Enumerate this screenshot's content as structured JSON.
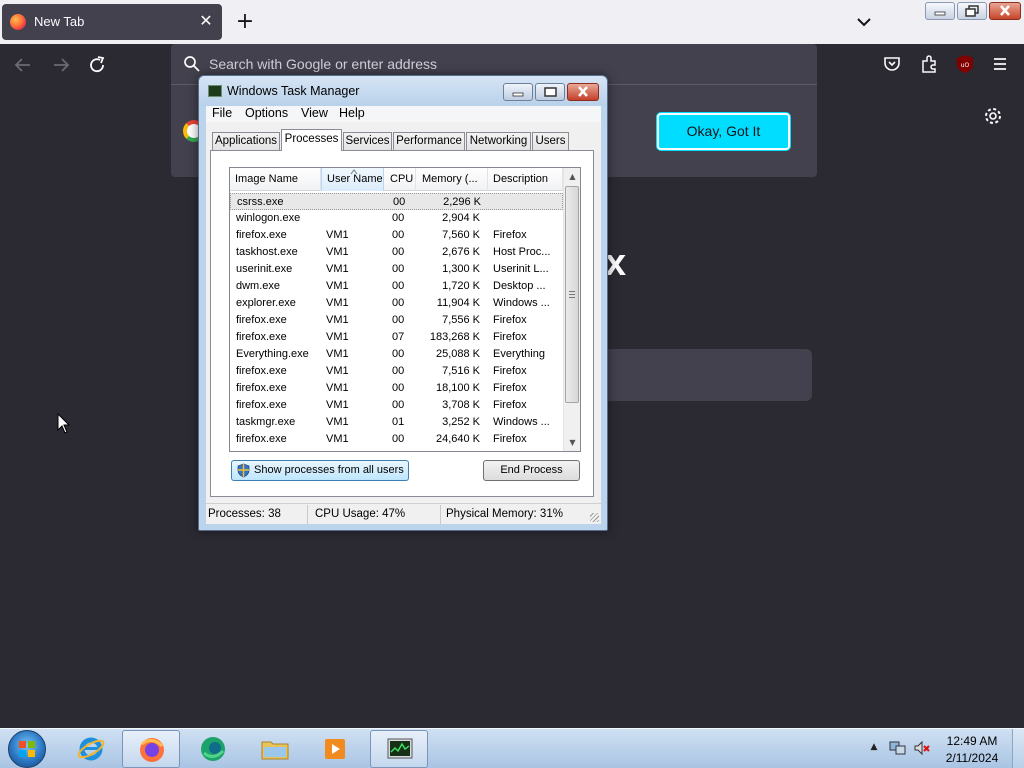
{
  "browser": {
    "tab_title": "New Tab",
    "tab_close": "✕",
    "new_tab": "+",
    "urlbar_placeholder": "Search with Google or enter address",
    "okay_button": "Okay, Got It",
    "wordmark_fragment": "x",
    "icons": {
      "tab": "firefox-icon",
      "back": "back-arrow-icon",
      "forward": "forward-arrow-icon",
      "reload": "reload-icon",
      "search": "search-icon",
      "google": "google-icon",
      "pocket": "pocket-icon",
      "extensions": "extensions-icon",
      "ublock": "ublock-origin-icon",
      "menu": "hamburger-menu-icon",
      "settings": "gear-icon"
    },
    "colors": {
      "accent": "#00ddff",
      "dark_bg": "#2b2a33",
      "panel_bg": "#42414d"
    }
  },
  "task_manager": {
    "title": "Windows Task Manager",
    "menu": [
      "File",
      "Options",
      "View",
      "Help"
    ],
    "tabs": [
      "Applications",
      "Processes",
      "Services",
      "Performance",
      "Networking",
      "Users"
    ],
    "active_tab": "Processes",
    "columns": [
      "Image Name",
      "User Name",
      "CPU",
      "Memory (...",
      "Description"
    ],
    "sorted_column": "User Name",
    "processes": [
      {
        "name": "csrss.exe",
        "user": "",
        "cpu": "00",
        "memory": "2,296 K",
        "description": ""
      },
      {
        "name": "winlogon.exe",
        "user": "",
        "cpu": "00",
        "memory": "2,904 K",
        "description": ""
      },
      {
        "name": "firefox.exe",
        "user": "VM1",
        "cpu": "00",
        "memory": "7,560 K",
        "description": "Firefox"
      },
      {
        "name": "taskhost.exe",
        "user": "VM1",
        "cpu": "00",
        "memory": "2,676 K",
        "description": "Host Proc..."
      },
      {
        "name": "userinit.exe",
        "user": "VM1",
        "cpu": "00",
        "memory": "1,300 K",
        "description": "Userinit L..."
      },
      {
        "name": "dwm.exe",
        "user": "VM1",
        "cpu": "00",
        "memory": "1,720 K",
        "description": "Desktop ..."
      },
      {
        "name": "explorer.exe",
        "user": "VM1",
        "cpu": "00",
        "memory": "11,904 K",
        "description": "Windows ..."
      },
      {
        "name": "firefox.exe",
        "user": "VM1",
        "cpu": "00",
        "memory": "7,556 K",
        "description": "Firefox"
      },
      {
        "name": "firefox.exe",
        "user": "VM1",
        "cpu": "07",
        "memory": "183,268 K",
        "description": "Firefox"
      },
      {
        "name": "Everything.exe",
        "user": "VM1",
        "cpu": "00",
        "memory": "25,088 K",
        "description": "Everything"
      },
      {
        "name": "firefox.exe",
        "user": "VM1",
        "cpu": "00",
        "memory": "7,516 K",
        "description": "Firefox"
      },
      {
        "name": "firefox.exe",
        "user": "VM1",
        "cpu": "00",
        "memory": "18,100 K",
        "description": "Firefox"
      },
      {
        "name": "firefox.exe",
        "user": "VM1",
        "cpu": "00",
        "memory": "3,708 K",
        "description": "Firefox"
      },
      {
        "name": "taskmgr.exe",
        "user": "VM1",
        "cpu": "01",
        "memory": "3,252 K",
        "description": "Windows ..."
      },
      {
        "name": "firefox.exe",
        "user": "VM1",
        "cpu": "00",
        "memory": "24,640 K",
        "description": "Firefox"
      }
    ],
    "selected_row": 0,
    "show_all_button": "Show processes from all users",
    "end_process_button": "End Process",
    "status": {
      "processes": "Processes: 38",
      "cpu": "CPU Usage: 47%",
      "memory": "Physical Memory: 31%"
    }
  },
  "taskbar": {
    "apps": [
      {
        "id": "ie",
        "icon": "internet-explorer-icon"
      },
      {
        "id": "firefox",
        "icon": "firefox-icon"
      },
      {
        "id": "edge",
        "icon": "edge-icon"
      },
      {
        "id": "explorer",
        "icon": "folder-icon"
      },
      {
        "id": "media",
        "icon": "media-player-icon"
      },
      {
        "id": "taskmgr",
        "icon": "task-manager-icon"
      }
    ],
    "clock_time": "12:49 AM",
    "clock_date": "2/11/2024"
  }
}
